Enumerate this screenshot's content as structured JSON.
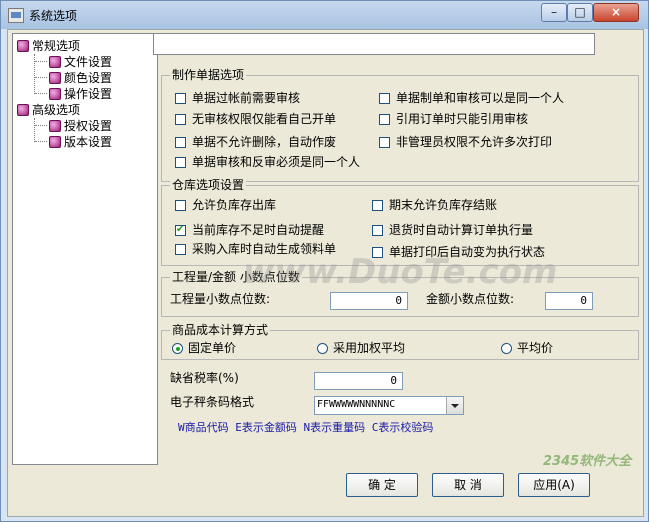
{
  "window": {
    "title": "系统选项",
    "controls": {
      "minimize": "–",
      "maximize": "□",
      "close": "×"
    }
  },
  "tree": {
    "nodes": [
      {
        "label": "常规选项"
      },
      {
        "label": "文件设置"
      },
      {
        "label": "颜色设置"
      },
      {
        "label": "操作设置"
      },
      {
        "label": "高级选项"
      },
      {
        "label": "授权设置"
      },
      {
        "label": "版本设置"
      }
    ]
  },
  "group_bill": {
    "title": "制作单据选项",
    "options": [
      {
        "label": "单据过帐前需要审核",
        "checked": false
      },
      {
        "label": "单据制单和审核可以是同一个人",
        "checked": false
      },
      {
        "label": "无审核权限仅能看自己开单",
        "checked": false
      },
      {
        "label": "引用订单时只能引用审核",
        "checked": false
      },
      {
        "label": "单据不允许删除，自动作废",
        "checked": false
      },
      {
        "label": "非管理员权限不允许多次打印",
        "checked": false
      },
      {
        "label": "单据审核和反审必须是同一个人",
        "checked": false
      }
    ]
  },
  "group_warehouse": {
    "title": "仓库选项设置",
    "options": [
      {
        "label": "允许负库存出库",
        "checked": false
      },
      {
        "label": "期末允许负库存结账",
        "checked": false
      },
      {
        "label": "当前库存不足时自动提醒",
        "checked": true
      },
      {
        "label": "退货时自动计算订单执行量",
        "checked": false
      },
      {
        "label": "采购入库时自动生成领料单",
        "checked": false
      },
      {
        "label": "单据打印后自动变为执行状态",
        "checked": false
      }
    ]
  },
  "group_decimal": {
    "title": "工程量/金额  小数点位数",
    "qty_label": "工程量小数点位数:",
    "qty_value": "0",
    "amount_label": "金额小数点位数:",
    "amount_value": "0"
  },
  "group_cost": {
    "title": "商品成本计算方式",
    "options": [
      {
        "label": "固定单价",
        "selected": true
      },
      {
        "label": "采用加权平均",
        "selected": false
      },
      {
        "label": "平均价",
        "selected": false
      }
    ]
  },
  "tax": {
    "label": "缺省税率(%)",
    "value": "0"
  },
  "barcode": {
    "label": "电子秤条码格式",
    "selected": "FFWWWWWNNNNNC",
    "hint": "W商品代码 E表示金额码 N表示重量码 C表示校验码"
  },
  "buttons": {
    "ok": "确  定",
    "cancel": "取  消",
    "apply": "应用(A)"
  },
  "watermarks": {
    "center": "www.DuoTe.com",
    "corner": "2345软件大全"
  }
}
